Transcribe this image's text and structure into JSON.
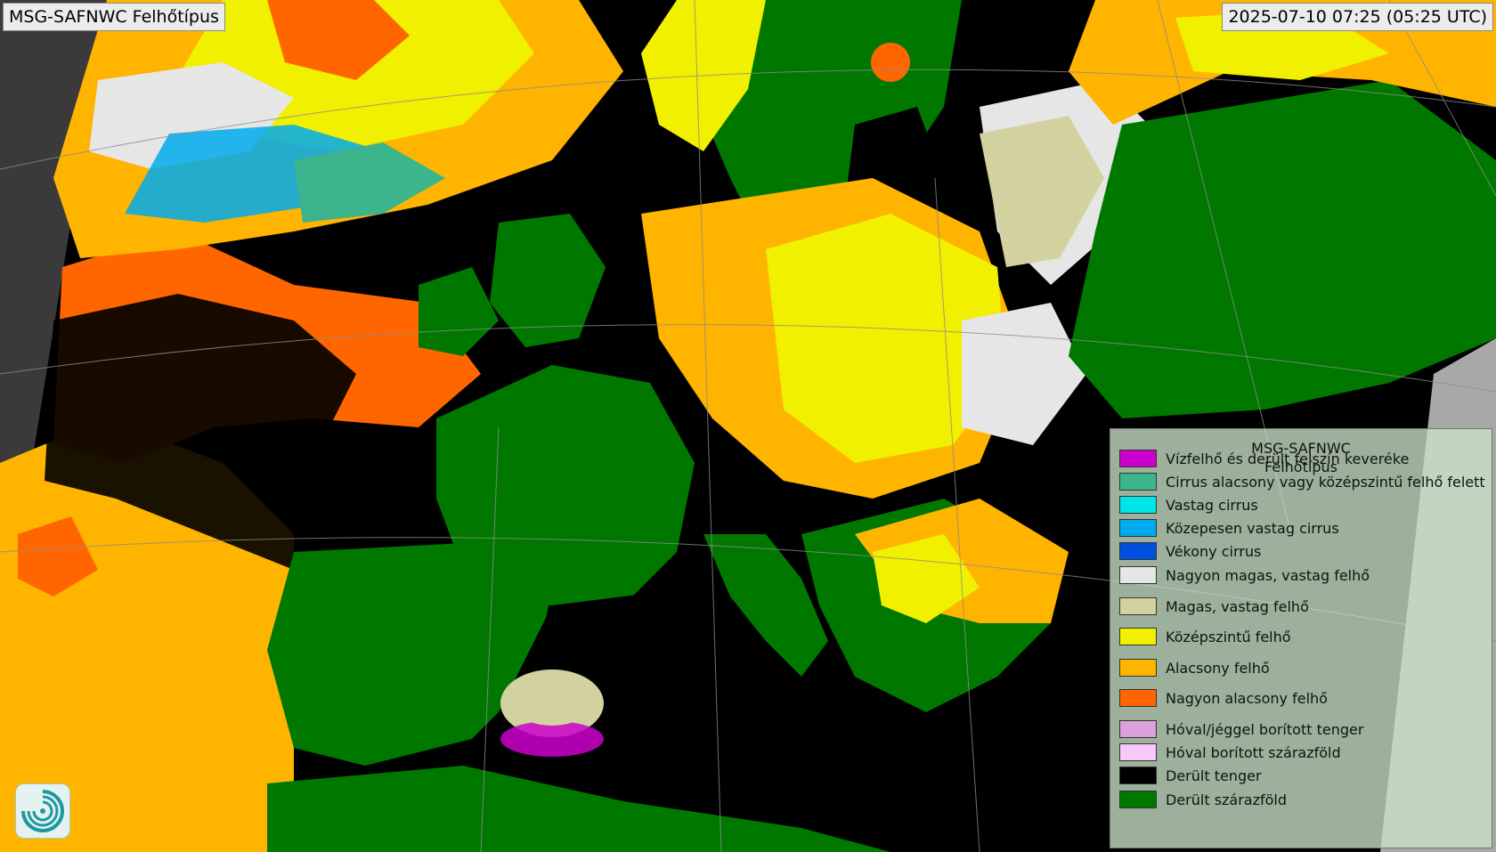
{
  "header": {
    "title": "MSG-SAFNWC Felhőtípus",
    "timestamp": "2025-07-10 07:25 (05:25 UTC)"
  },
  "map": {
    "content": "satellite-cloud-type-map",
    "region": "Europe"
  },
  "legend": {
    "title": "MSG-SAFNWC",
    "subtitle": "Felhőtípus",
    "items": [
      {
        "label": "Vízfelhő és derült felszín keveréke",
        "color": "#cc00cc"
      },
      {
        "label": "Cirrus alacsony vagy középszintű felhő felett",
        "color": "#3cb48c"
      },
      {
        "label": "Vastag cirrus",
        "color": "#00e6e6"
      },
      {
        "label": "Közepesen vastag cirrus",
        "color": "#00aaee"
      },
      {
        "label": "Vékony cirrus",
        "color": "#0050e0"
      },
      {
        "label": "Nagyon magas, vastag felhő",
        "color": "#e6e6e6"
      },
      {
        "label": "Magas, vastag felhő",
        "color": "#d2d2a0"
      },
      {
        "label": "Középszintű felhő",
        "color": "#f0f000"
      },
      {
        "label": "Alacsony felhő",
        "color": "#ffb400"
      },
      {
        "label": "Nagyon alacsony felhő",
        "color": "#ff6600"
      },
      {
        "label": "Hóval/jéggel borított tenger",
        "color": "#dca0dc"
      },
      {
        "label": "Hóval borított szárazföld",
        "color": "#f8c8f8"
      },
      {
        "label": "Derült tenger",
        "color": "#000000"
      },
      {
        "label": "Derült szárazföld",
        "color": "#007800"
      }
    ]
  },
  "logo": {
    "icon": "swirl-logo-icon"
  }
}
